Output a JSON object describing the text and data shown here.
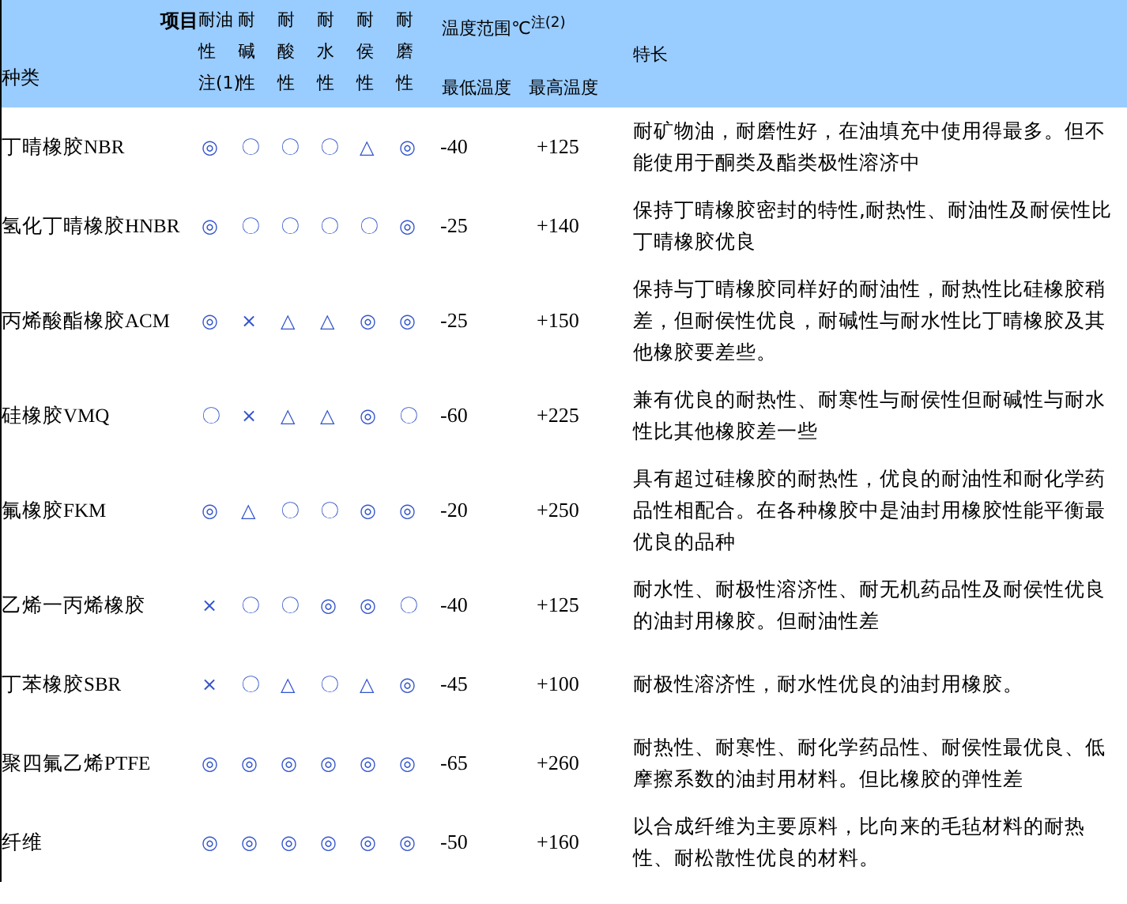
{
  "header": {
    "item_label": "项目",
    "type_label": "种类",
    "properties": [
      {
        "lines": [
          "耐油",
          "性",
          "注(1)"
        ]
      },
      {
        "lines": [
          "耐",
          "碱",
          "性"
        ]
      },
      {
        "lines": [
          "耐",
          "酸",
          "性"
        ]
      },
      {
        "lines": [
          "耐",
          "水",
          "性"
        ]
      },
      {
        "lines": [
          "耐",
          "侯",
          "性"
        ]
      },
      {
        "lines": [
          "耐",
          "磨",
          "性"
        ]
      }
    ],
    "temperature": "温度范围℃$^{注(2)}$",
    "min_temp": "最低温度",
    "max_temp": "最高温度",
    "features": "特长"
  },
  "rows": [
    {
      "name": "丁晴橡胶NBR",
      "marks": [
        "◎",
        "〇",
        "〇",
        "〇",
        "△",
        "◎"
      ],
      "min": "-40",
      "max": "+125",
      "features": "耐矿物油，耐磨性好，在油填充中使用得最多。但不能使用于酮类及酯类极性溶济中"
    },
    {
      "name": "氢化丁晴橡胶HNBR",
      "marks": [
        "◎",
        "〇",
        "〇",
        "〇",
        "〇",
        "◎"
      ],
      "min": "-25",
      "max": "+140",
      "features": "保持丁晴橡胶密封的特性,耐热性、耐油性及耐侯性比丁晴橡胶优良"
    },
    {
      "name": "丙烯酸酯橡胶ACM",
      "marks": [
        "◎",
        "×",
        "△",
        "△",
        "◎",
        "◎"
      ],
      "min": "-25",
      "max": "+150",
      "features": "保持与丁晴橡胶同样好的耐油性，耐热性比硅橡胶稍差，但耐侯性优良，耐碱性与耐水性比丁晴橡胶及其他橡胶要差些。"
    },
    {
      "name": "硅橡胶VMQ",
      "marks": [
        "〇",
        "×",
        "△",
        "△",
        "◎",
        "〇"
      ],
      "min": "-60",
      "max": "+225",
      "features": "兼有优良的耐热性、耐寒性与耐侯性但耐碱性与耐水性比其他橡胶差一些"
    },
    {
      "name": "氟橡胶FKM",
      "marks": [
        "◎",
        "△",
        "〇",
        "〇",
        "◎",
        "◎"
      ],
      "min": "-20",
      "max": "+250",
      "features": "具有超过硅橡胶的耐热性，优良的耐油性和耐化学药品性相配合。在各种橡胶中是油封用橡胶性能平衡最优良的品种"
    },
    {
      "name": "乙烯一丙烯橡胶",
      "marks": [
        "×",
        "〇",
        "〇",
        "◎",
        "◎",
        "〇"
      ],
      "min": "-40",
      "max": "+125",
      "features": "耐水性、耐极性溶济性、耐无机药品性及耐侯性优良的油封用橡胶。但耐油性差"
    },
    {
      "name": "丁苯橡胶SBR",
      "marks": [
        "×",
        "〇",
        "△",
        "〇",
        "△",
        "◎"
      ],
      "min": "-45",
      "max": "+100",
      "features": "耐极性溶济性，耐水性优良的油封用橡胶。"
    },
    {
      "name": "聚四氟乙烯PTFE",
      "marks": [
        "◎",
        "◎",
        "◎",
        "◎",
        "◎",
        "◎"
      ],
      "min": "-65",
      "max": "+260",
      "features": "耐热性、耐寒性、耐化学药品性、耐侯性最优良、低摩擦系数的油封用材料。但比橡胶的弹性差"
    },
    {
      "name": "纤维",
      "marks": [
        "◎",
        "◎",
        "◎",
        "◎",
        "◎",
        "◎"
      ],
      "min": "-50",
      "max": "+160",
      "features": "以合成纤维为主要原料，比向来的毛毡材料的耐热性、耐松散性优良的材料。"
    }
  ]
}
